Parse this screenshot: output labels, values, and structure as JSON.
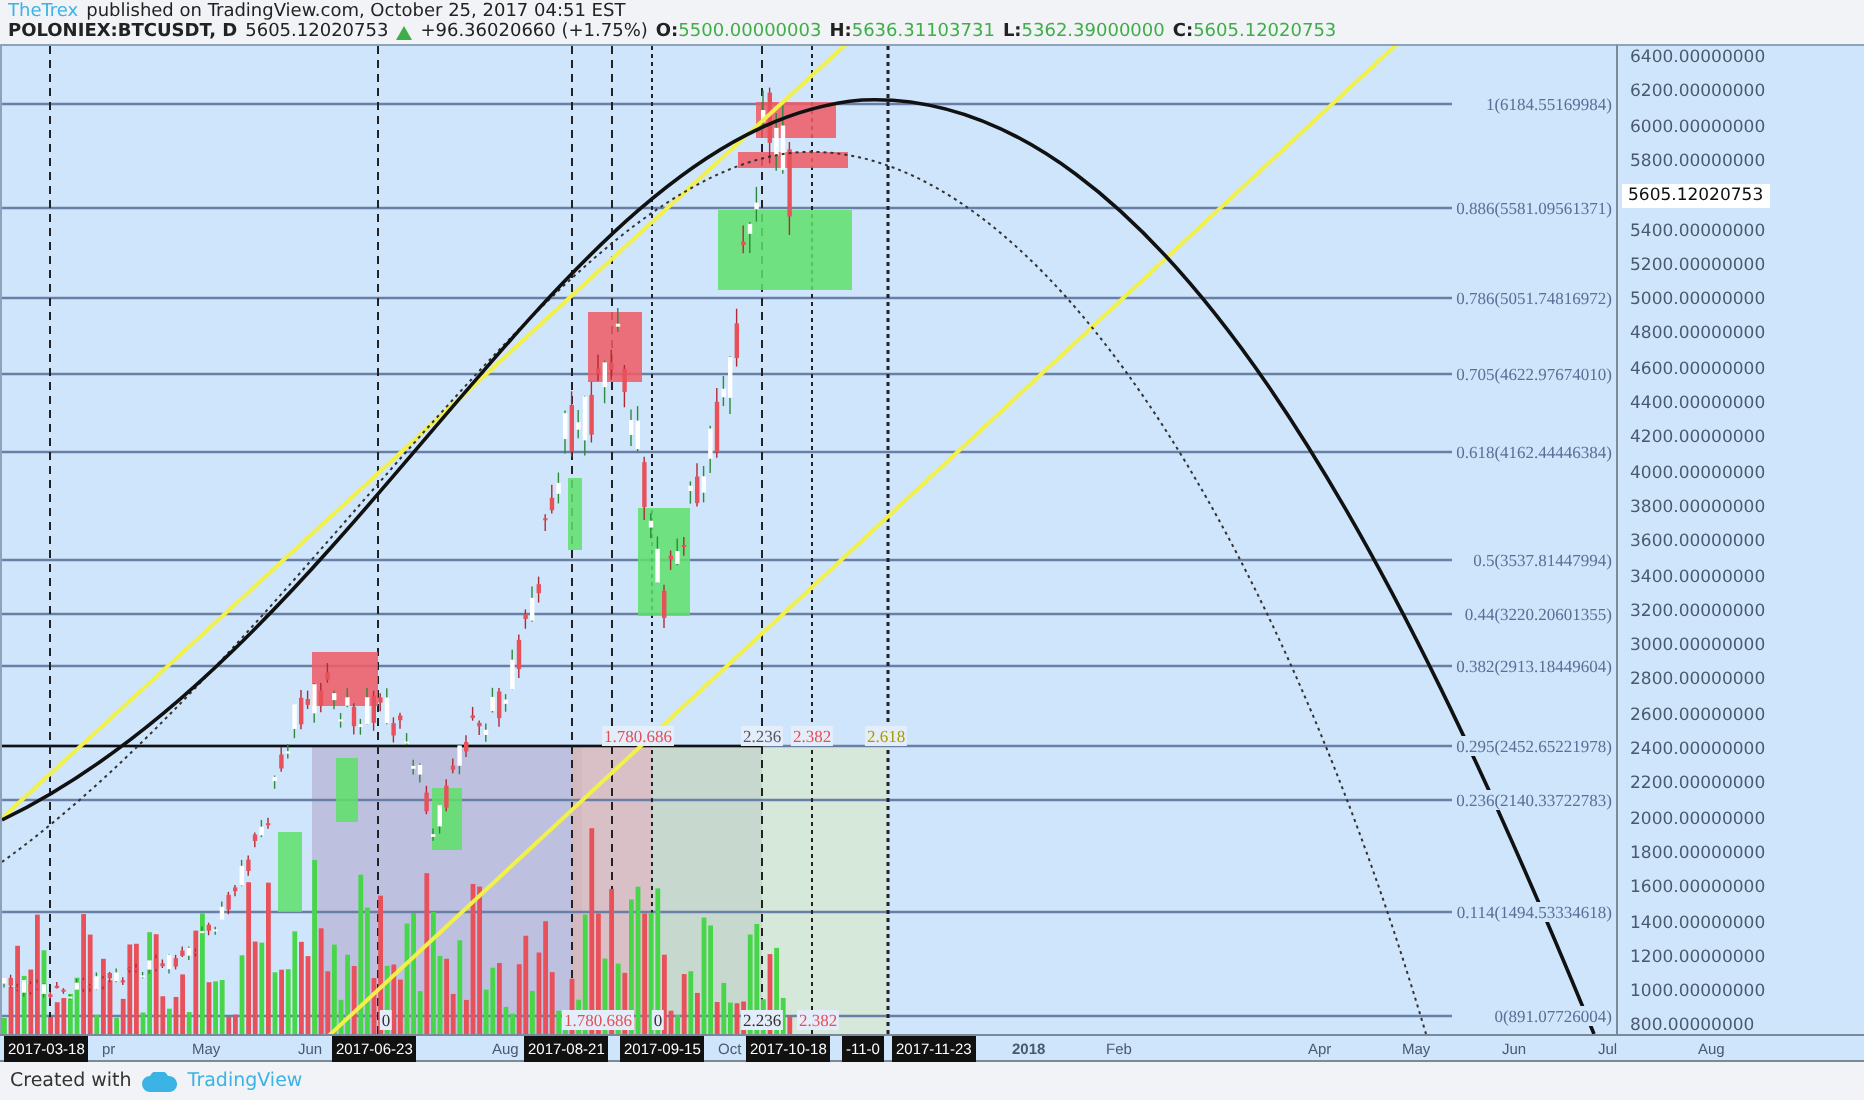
{
  "header": {
    "author": "TheTrex",
    "published": "published on TradingView.com, October 25, 2017 04:51 EST"
  },
  "quote": {
    "symbol": "POLONIEX:BTCUSDT, D",
    "last": "5605.12020753",
    "change": "+96.36020660 (+1.75%)",
    "fields": [
      {
        "key": "O:",
        "value": "5500.00000003"
      },
      {
        "key": "H:",
        "value": "5636.31103731"
      },
      {
        "key": "L:",
        "value": "5362.39000000"
      },
      {
        "key": "C:",
        "value": "5605.12020753"
      }
    ]
  },
  "chart": {
    "fib_levels": [
      "1(6184.55169984)",
      "0.886(5581.09561371)",
      "0.786(5051.74816972)",
      "0.705(4622.97674010)",
      "0.618(4162.44446384)",
      "0.5(3537.81447994)",
      "0.44(3220.20601355)",
      "0.382(2913.18449604)",
      "0.295(2452.65221978)",
      "0.236(2140.33722783)",
      "0.114(1494.53334618)",
      "0(891.07726004)"
    ],
    "cycle_labels_top": [
      {
        "text": "1.780.686",
        "color": "#e0505a"
      },
      {
        "text": "2.236",
        "color": "#555566"
      },
      {
        "text": "2.382",
        "color": "#e0505a"
      },
      {
        "text": "2.618",
        "color": "#a89a00"
      }
    ],
    "cycle_labels_bottom": [
      {
        "text": "0",
        "color": "#333333"
      },
      {
        "text": "1.780.686",
        "color": "#e0505a"
      },
      {
        "text": "0",
        "color": "#333333"
      },
      {
        "text": "2.236",
        "color": "#333333"
      },
      {
        "text": "2.382",
        "color": "#e0505a"
      }
    ]
  },
  "price_axis": {
    "ticks": [
      "6400.00000000",
      "6200.00000000",
      "6000.00000000",
      "5800.00000000",
      "5400.00000000",
      "5200.00000000",
      "5000.00000000",
      "4800.00000000",
      "4600.00000000",
      "4400.00000000",
      "4200.00000000",
      "4000.00000000",
      "3800.00000000",
      "3600.00000000",
      "3400.00000000",
      "3200.00000000",
      "3000.00000000",
      "2800.00000000",
      "2600.00000000",
      "2400.00000000",
      "2200.00000000",
      "2000.00000000",
      "1800.00000000",
      "1600.00000000",
      "1400.00000000",
      "1200.00000000",
      "1000.00000000",
      "800.00000000"
    ],
    "current_price": "5605.12020753"
  },
  "time_axis": [
    {
      "label": "2017-03-18",
      "kind": "marker"
    },
    {
      "label": "pr",
      "kind": "month"
    },
    {
      "label": "May",
      "kind": "month"
    },
    {
      "label": "Jun",
      "kind": "month"
    },
    {
      "label": "2017-06-23",
      "kind": "marker"
    },
    {
      "label": "Aug",
      "kind": "month"
    },
    {
      "label": "2017-08-21",
      "kind": "marker"
    },
    {
      "label": "2017-09-15",
      "kind": "marker"
    },
    {
      "label": "Oct",
      "kind": "month"
    },
    {
      "label": "2017-10-18",
      "kind": "marker"
    },
    {
      "label": "-11-0",
      "kind": "marker"
    },
    {
      "label": "2017-11-23",
      "kind": "marker"
    },
    {
      "label": "2018",
      "kind": "year"
    },
    {
      "label": "Feb",
      "kind": "month"
    },
    {
      "label": "Apr",
      "kind": "month"
    },
    {
      "label": "May",
      "kind": "month"
    },
    {
      "label": "Jun",
      "kind": "month"
    },
    {
      "label": "Jul",
      "kind": "month"
    },
    {
      "label": "Aug",
      "kind": "month"
    }
  ],
  "footer": {
    "created_with": "Created with",
    "brand": "TradingView"
  }
}
